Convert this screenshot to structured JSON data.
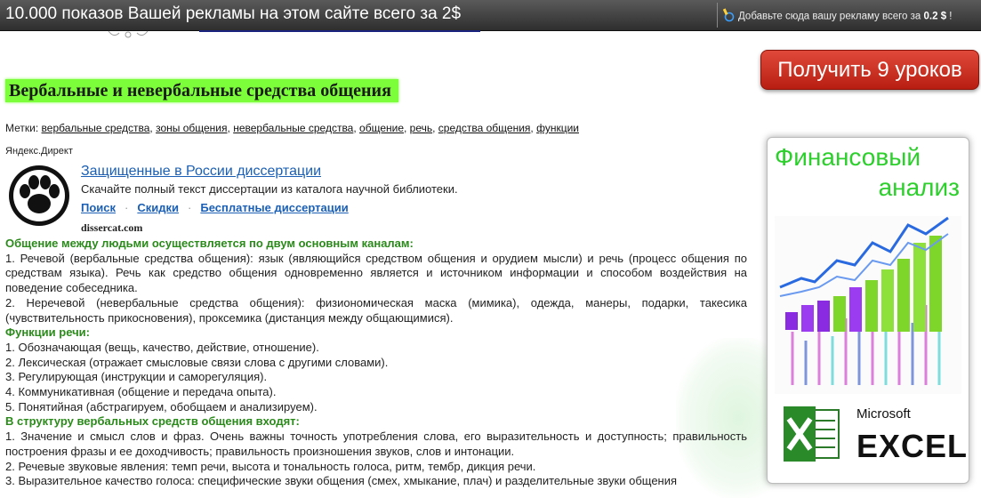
{
  "topbar": {
    "promo_text": "10.000 показов Вашей рекламы на этом сайте всего за 2$",
    "add_ad_text": "Добавьте сюда вашу рекламу всего за",
    "add_ad_price": "0.2 $",
    "add_ad_suffix": "!"
  },
  "headline": "Вербальные и невербальные средства общения",
  "tags": {
    "label": "Метки:",
    "items": [
      "вербальные средства",
      "зоны общения",
      "невербальные средства",
      "общение",
      "речь",
      "средства общения",
      "функции"
    ]
  },
  "direct_label": "Яндекс.Директ",
  "ad": {
    "title": "Защищенные в России диссертации",
    "description": "Скачайте полный текст диссертации из каталога научной библиотеки.",
    "links": [
      "Поиск",
      "Скидки",
      "Бесплатные диссертации"
    ],
    "separator": "·",
    "domain": "dissercat.com"
  },
  "article": {
    "h1": "Общение между людьми осуществляется по двум основным каналам:",
    "p1": "1. Речевой (вербальные средства общения): язык (являющийся средством общения и орудием мысли) и речь (процесс общения по средствам языка). Речь как средство общения одновременно является и источником информации и способом воздействия на поведение собеседника.",
    "p2": "2. Неречевой (невербальные средства общения): физиономическая маска (мимика), одежда, манеры, подарки, такесика (чувствительность прикосновения), проксемика (дистанция между общающимися).",
    "h2": "Функции речи:",
    "functions": [
      "1. Обозначающая (вещь, качество, действие, отношение).",
      "2. Лексическая (отражает смысловые связи слова с другими словами).",
      "3. Регулирующая (инструкции и саморегуляция).",
      "4. Коммуникативная (общение и передача опыта).",
      "5. Понятийная (абстрагируем, обобщаем и анализируем)."
    ],
    "h3": "В структуру вербальных средств общения входят:",
    "s1": "1. Значение и смысл слов и фраз. Очень важны точность употребления слова, его выразительность и доступность; правильность построения фразы и ее доходчивость; правильность произношения звуков, слов и интонации.",
    "s2": "2. Речевые звуковые явления: темп речи, высота и тональность голоса, ритм, тембр, дикция речи.",
    "s3": "3. Выразительное качество голоса: специфические звуки общения (смех, хмыкание, плач) и разделительные звуки общения"
  },
  "cta_label": "Получить 9 уроков",
  "banner": {
    "title_line1": "Финансовый",
    "title_line2": "анализ",
    "brand_small": "Microsoft",
    "brand_big": "EXCEL"
  },
  "colors": {
    "headline_bg": "#7cff3a",
    "article_heading": "#2a8a1a",
    "link_blue": "#1a5fb4",
    "cta_red": "#c8281a",
    "banner_green": "#2ccf2c"
  }
}
